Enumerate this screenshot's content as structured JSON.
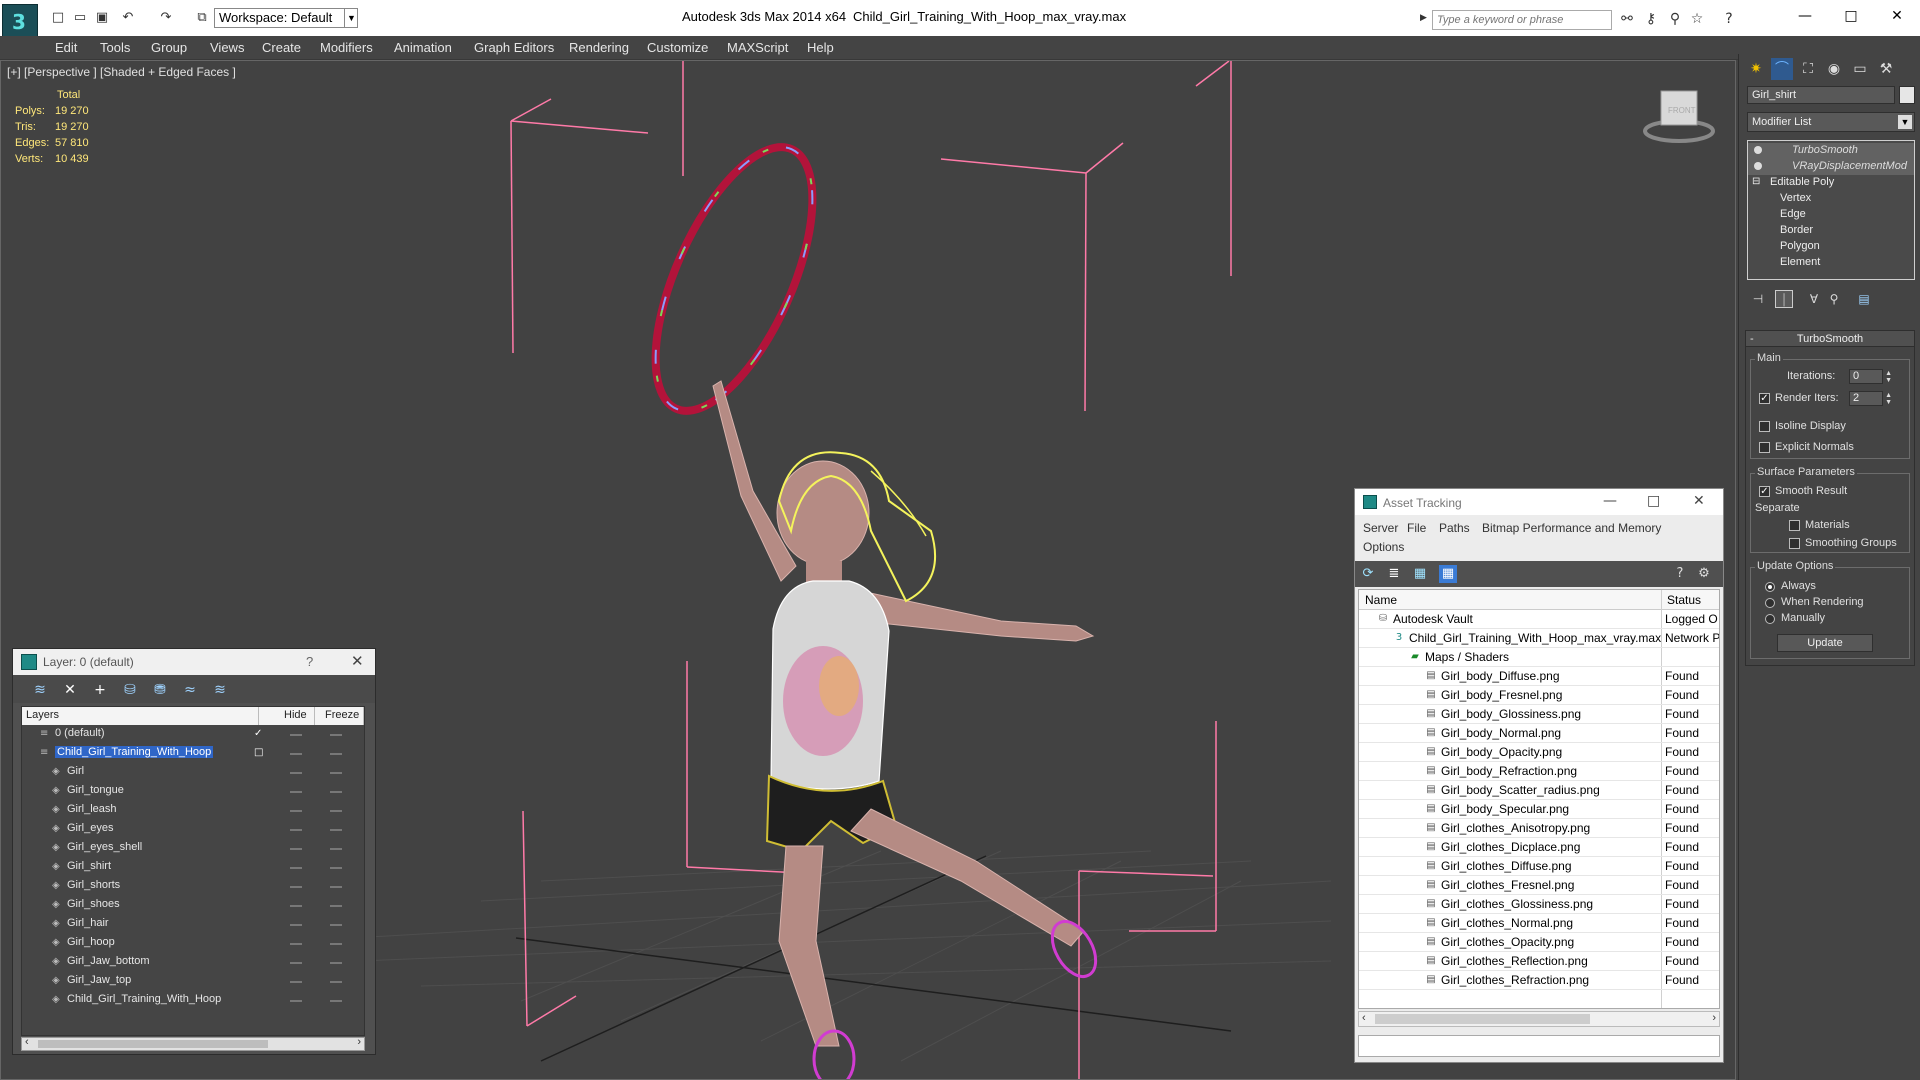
{
  "titlebar": {
    "workspace_label": "Workspace: Default",
    "app_title": "Autodesk 3ds Max  2014 x64",
    "document_title": "Child_Girl_Training_With_Hoop_max_vray.max",
    "search_placeholder": "Type a keyword or phrase"
  },
  "menu": {
    "items": [
      "Edit",
      "Tools",
      "Group",
      "Views",
      "Create",
      "Modifiers",
      "Animation",
      "Graph Editors",
      "Rendering",
      "Customize",
      "MAXScript",
      "Help"
    ]
  },
  "viewport": {
    "label": "[+] [Perspective ] [Shaded + Edged Faces ]",
    "nav_cube_label": "FRONT",
    "stats": {
      "header": "Total",
      "rows": [
        {
          "key": "Polys:",
          "value": "19 270"
        },
        {
          "key": "Tris:",
          "value": "19 270"
        },
        {
          "key": "Edges:",
          "value": "57 810"
        },
        {
          "key": "Verts:",
          "value": "10 439"
        }
      ]
    }
  },
  "layer_explorer": {
    "title": "Layer: 0 (default)",
    "help": "?",
    "columns": [
      "Layers",
      "Hide",
      "Freeze"
    ],
    "rows": [
      {
        "name": "0 (default)",
        "level": 0,
        "active": true
      },
      {
        "name": "Child_Girl_Training_With_Hoop",
        "level": 0,
        "selected": true
      },
      {
        "name": "Girl",
        "level": 1
      },
      {
        "name": "Girl_tongue",
        "level": 1
      },
      {
        "name": "Girl_leash",
        "level": 1
      },
      {
        "name": "Girl_eyes",
        "level": 1
      },
      {
        "name": "Girl_eyes_shell",
        "level": 1
      },
      {
        "name": "Girl_shirt",
        "level": 1
      },
      {
        "name": "Girl_shorts",
        "level": 1
      },
      {
        "name": "Girl_shoes",
        "level": 1
      },
      {
        "name": "Girl_hair",
        "level": 1
      },
      {
        "name": "Girl_hoop",
        "level": 1
      },
      {
        "name": "Girl_Jaw_bottom",
        "level": 1
      },
      {
        "name": "Girl_Jaw_top",
        "level": 1
      },
      {
        "name": "Child_Girl_Training_With_Hoop",
        "level": 1
      }
    ]
  },
  "asset_tracking": {
    "title": "Asset Tracking",
    "menu": [
      "Server",
      "File",
      "Paths",
      "Bitmap Performance and Memory",
      "Options"
    ],
    "columns": [
      "Name",
      "Status"
    ],
    "rows": [
      {
        "name": "Autodesk Vault",
        "status": "Logged O",
        "level": 0,
        "icon": "vault"
      },
      {
        "name": "Child_Girl_Training_With_Hoop_max_vray.max",
        "status": "Network P",
        "level": 1,
        "icon": "max"
      },
      {
        "name": "Maps / Shaders",
        "status": "",
        "level": 2,
        "icon": "maps"
      },
      {
        "name": "Girl_body_Diffuse.png",
        "status": "Found",
        "level": 3,
        "icon": "file"
      },
      {
        "name": "Girl_body_Fresnel.png",
        "status": "Found",
        "level": 3,
        "icon": "file"
      },
      {
        "name": "Girl_body_Glossiness.png",
        "status": "Found",
        "level": 3,
        "icon": "file"
      },
      {
        "name": "Girl_body_Normal.png",
        "status": "Found",
        "level": 3,
        "icon": "file"
      },
      {
        "name": "Girl_body_Opacity.png",
        "status": "Found",
        "level": 3,
        "icon": "file"
      },
      {
        "name": "Girl_body_Refraction.png",
        "status": "Found",
        "level": 3,
        "icon": "file"
      },
      {
        "name": "Girl_body_Scatter_radius.png",
        "status": "Found",
        "level": 3,
        "icon": "file"
      },
      {
        "name": "Girl_body_Specular.png",
        "status": "Found",
        "level": 3,
        "icon": "file"
      },
      {
        "name": "Girl_clothes_Anisotropy.png",
        "status": "Found",
        "level": 3,
        "icon": "file"
      },
      {
        "name": "Girl_clothes_Dicplace.png",
        "status": "Found",
        "level": 3,
        "icon": "file"
      },
      {
        "name": "Girl_clothes_Diffuse.png",
        "status": "Found",
        "level": 3,
        "icon": "file"
      },
      {
        "name": "Girl_clothes_Fresnel.png",
        "status": "Found",
        "level": 3,
        "icon": "file"
      },
      {
        "name": "Girl_clothes_Glossiness.png",
        "status": "Found",
        "level": 3,
        "icon": "file"
      },
      {
        "name": "Girl_clothes_Normal.png",
        "status": "Found",
        "level": 3,
        "icon": "file"
      },
      {
        "name": "Girl_clothes_Opacity.png",
        "status": "Found",
        "level": 3,
        "icon": "file"
      },
      {
        "name": "Girl_clothes_Reflection.png",
        "status": "Found",
        "level": 3,
        "icon": "file"
      },
      {
        "name": "Girl_clothes_Refraction.png",
        "status": "Found",
        "level": 3,
        "icon": "file"
      }
    ]
  },
  "command_panel": {
    "object_name": "Girl_shirt",
    "modifier_list_label": "Modifier List",
    "stack": [
      {
        "name": "TurboSmooth",
        "type": "modifier"
      },
      {
        "name": "VRayDisplacementMod",
        "type": "modifier"
      },
      {
        "name": "Editable Poly",
        "type": "base"
      },
      {
        "name": "Vertex",
        "type": "sub"
      },
      {
        "name": "Edge",
        "type": "sub"
      },
      {
        "name": "Border",
        "type": "sub"
      },
      {
        "name": "Polygon",
        "type": "sub"
      },
      {
        "name": "Element",
        "type": "sub"
      }
    ],
    "turbosmooth": {
      "title": "TurboSmooth",
      "main_label": "Main",
      "iterations_label": "Iterations:",
      "iterations_value": "0",
      "render_iters_label": "Render Iters:",
      "render_iters_value": "2",
      "render_iters_checked": true,
      "isoline_label": "Isoline Display",
      "explicit_normals_label": "Explicit Normals",
      "surface_label": "Surface Parameters",
      "smooth_result_label": "Smooth Result",
      "separate_label": "Separate",
      "materials_label": "Materials",
      "smoothing_groups_label": "Smoothing Groups",
      "update_options_label": "Update Options",
      "always_label": "Always",
      "when_rendering_label": "When Rendering",
      "manually_label": "Manually",
      "update_button_label": "Update"
    }
  },
  "colors": {
    "viewport_bg": "#424242",
    "bounding_box": "#ff7aa8",
    "selection_blue": "#2f66c8",
    "stats_yellow": "#ffe77a"
  }
}
